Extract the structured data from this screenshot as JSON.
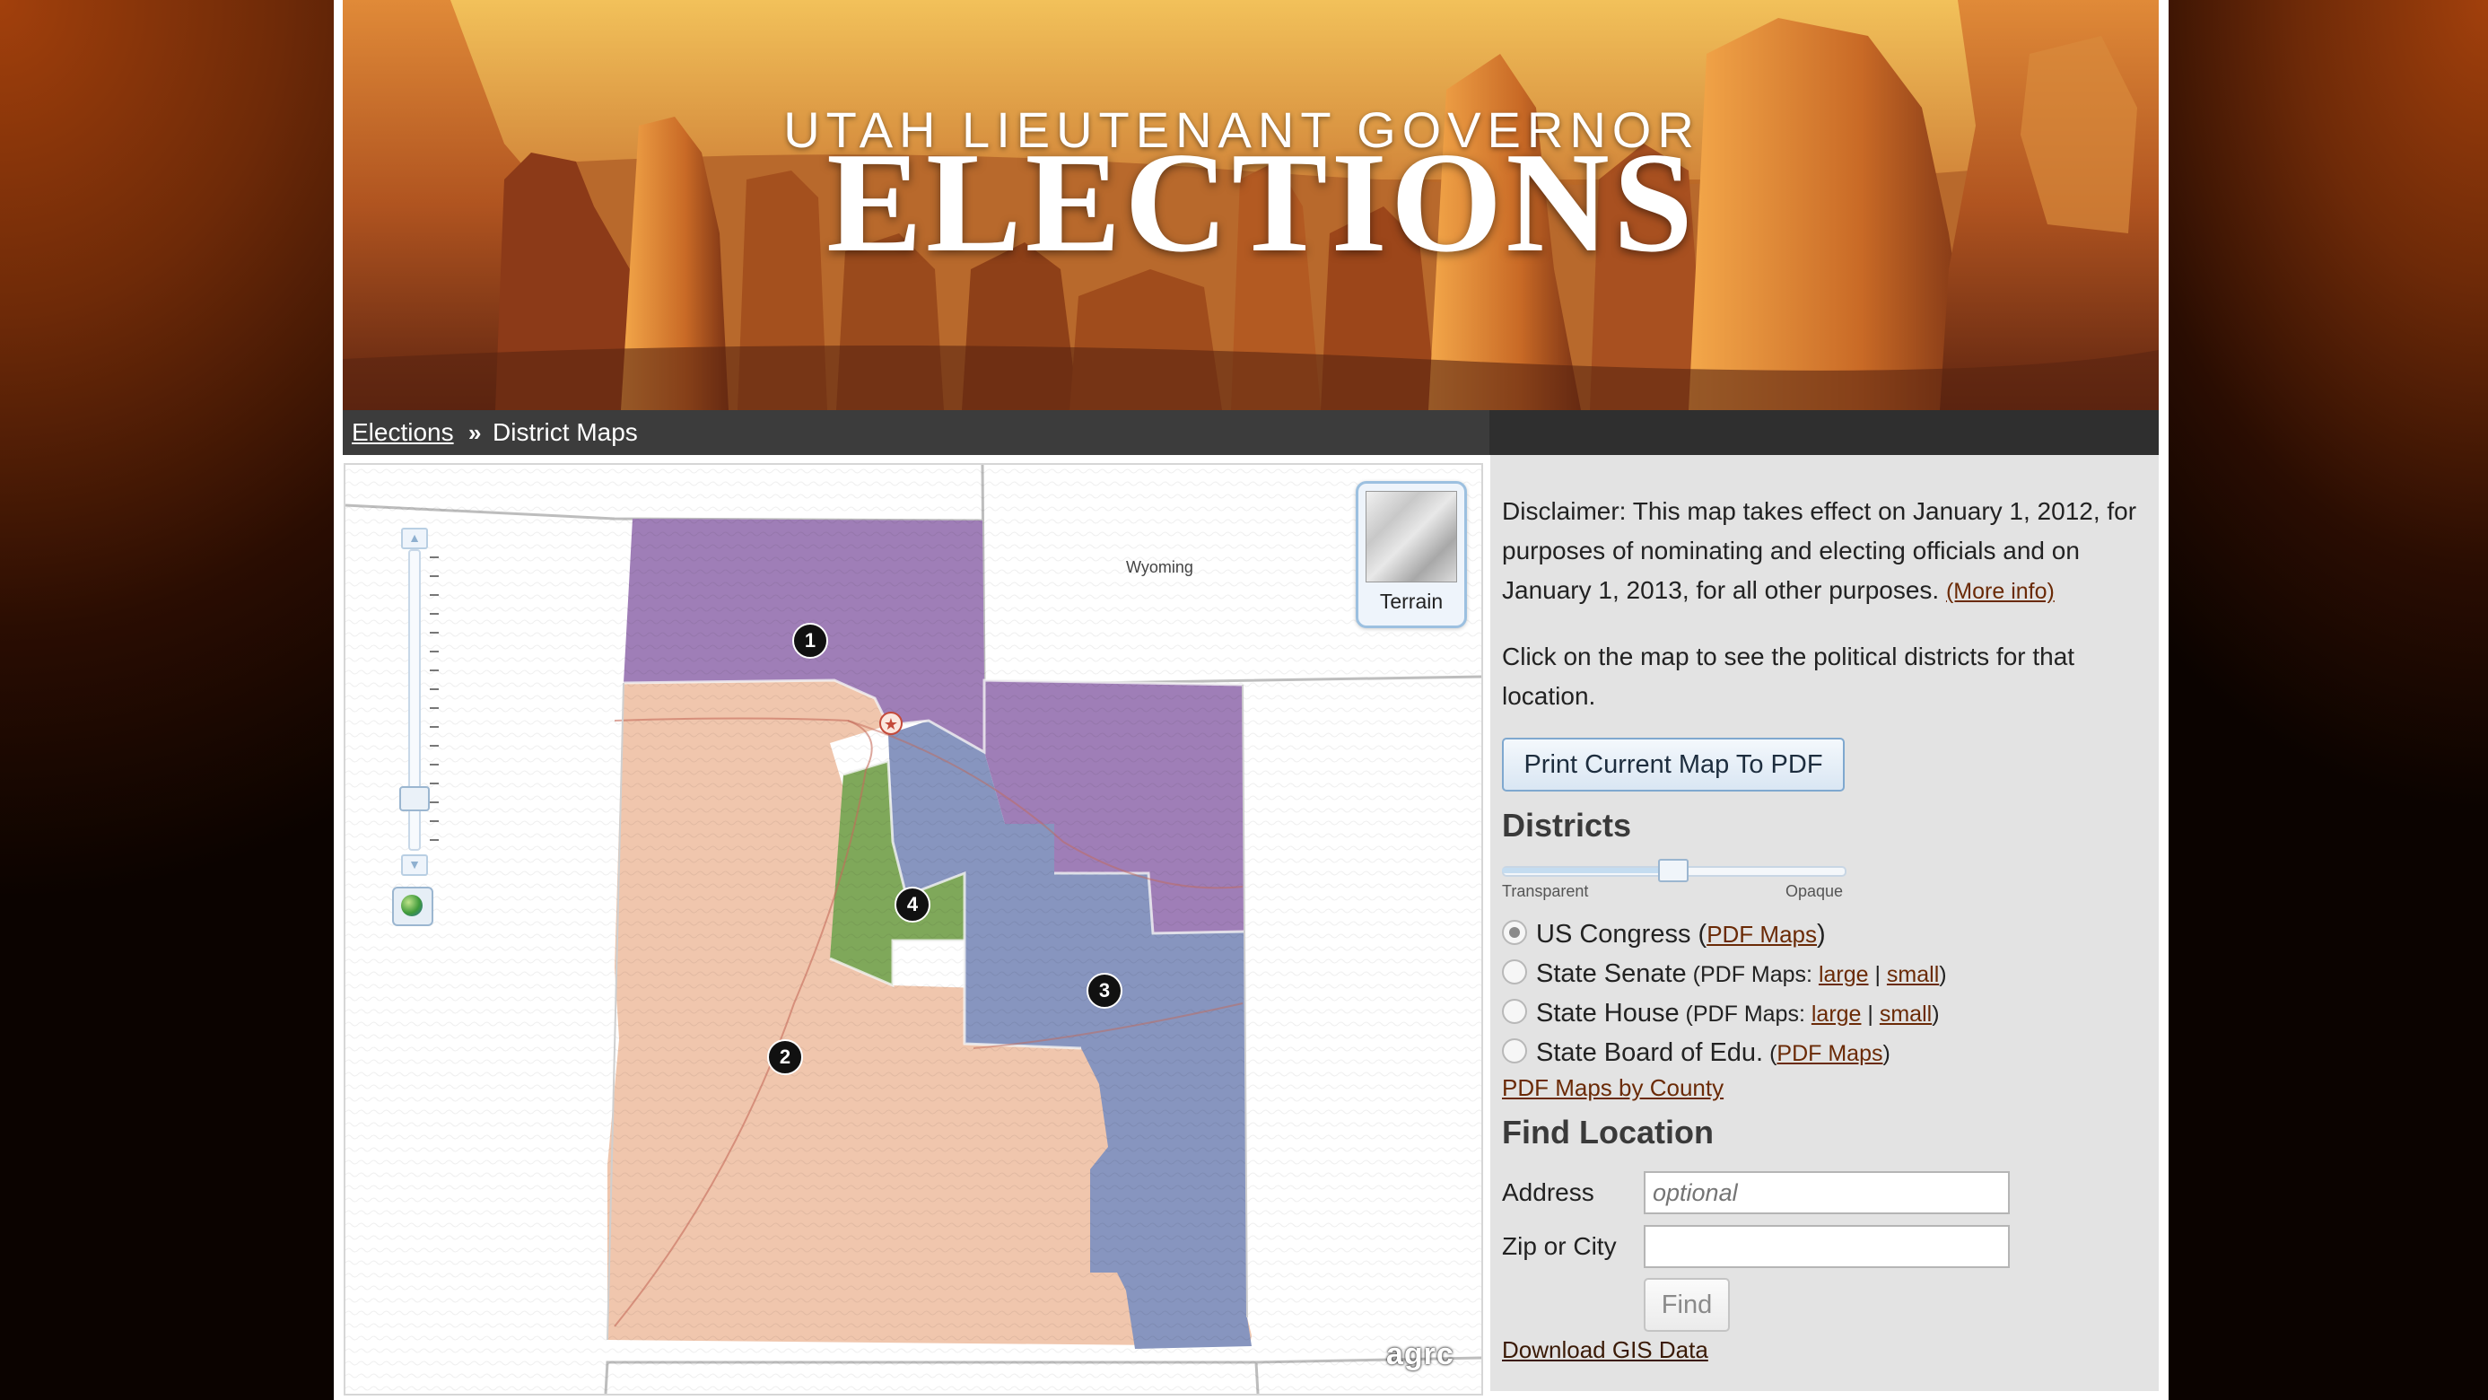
{
  "banner": {
    "subtitle": "UTAH LIEUTENANT GOVERNOR",
    "title": "ELECTIONS"
  },
  "breadcrumb": {
    "home": "Elections",
    "separator": "»",
    "current": "District Maps"
  },
  "map": {
    "neighbor_label": "Wyoming",
    "basemap_button": "Terrain",
    "logo": "agrc",
    "district_markers": [
      "1",
      "2",
      "3",
      "4"
    ],
    "colors": {
      "district_1": "#9f7eb7",
      "district_2": "#f0c6ad",
      "district_3": "#8795bf",
      "district_4": "#7fa85a"
    }
  },
  "panel": {
    "disclaimer": "Disclaimer: This map takes effect on January 1, 2012, for purposes of nominating and electing officials and on January 1, 2013, for all other purposes.",
    "more_info": "(More info)",
    "instruction": "Click on the map to see the political districts for that location.",
    "print_button": "Print Current Map To PDF",
    "districts_heading": "Districts",
    "opacity": {
      "left_label": "Transparent",
      "right_label": "Opaque",
      "value": 0.5
    },
    "layers": [
      {
        "name": "US Congress",
        "open": " (",
        "pdf_label": "PDF Maps",
        "close": ")",
        "selected": true
      },
      {
        "name": "State Senate",
        "pdf_prefix": " (PDF Maps: ",
        "large": "large",
        "divider": " | ",
        "small": "small",
        "close": ")",
        "selected": false
      },
      {
        "name": "State House",
        "pdf_prefix": " (PDF Maps: ",
        "large": "large",
        "divider": " | ",
        "small": "small",
        "close": ")",
        "selected": false
      },
      {
        "name": "State Board of Edu.",
        "open": " (",
        "pdf_label": "PDF Maps",
        "close": ")",
        "selected": false
      }
    ],
    "pdf_by_county": "PDF Maps by County",
    "find_heading": "Find Location",
    "address_label": "Address",
    "address_placeholder": "optional",
    "zip_label": "Zip or City",
    "zip_value": "",
    "find_button": "Find",
    "gis_link": "Download GIS Data"
  }
}
